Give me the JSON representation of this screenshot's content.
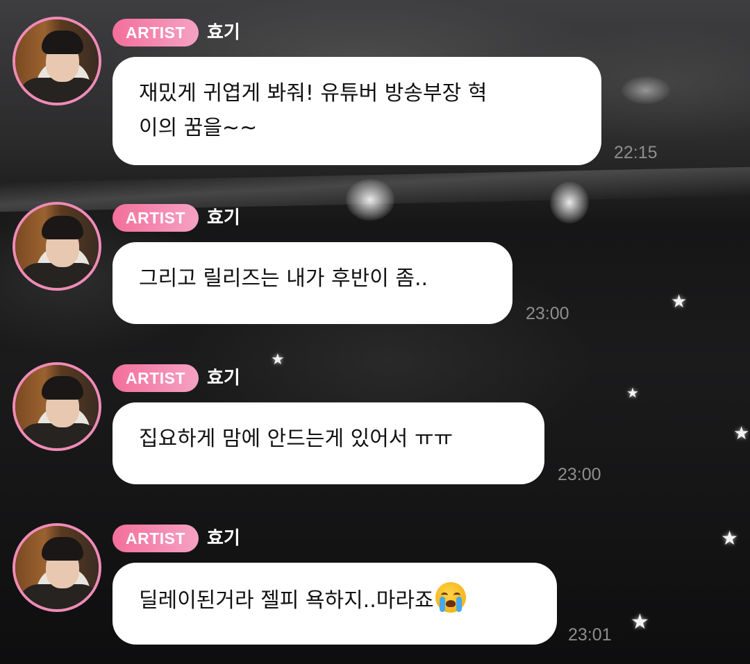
{
  "messages": [
    {
      "badge": "ARTIST",
      "sender": "효기",
      "text_lines": [
        "재밌게 귀엽게 봐줘! 유튜버 방송부장 혁",
        "이의 꿈을~~"
      ],
      "time": "22:15",
      "avatar": "artist-profile-photo"
    },
    {
      "badge": "ARTIST",
      "sender": "효기",
      "text_lines": [
        "그리고 릴리즈는 내가 후반이 좀.."
      ],
      "time": "23:00",
      "avatar": "artist-profile-photo"
    },
    {
      "badge": "ARTIST",
      "sender": "효기",
      "text_lines": [
        "집요하게 맘에 안드는게 있어서 ㅠㅠ"
      ],
      "time": "23:00",
      "avatar": "artist-profile-photo"
    },
    {
      "badge": "ARTIST",
      "sender": "효기",
      "text_lines": [
        "딜레이된거라 젤피 욕하지..마라죠"
      ],
      "emoji": "loudly-crying-face",
      "time": "23:01",
      "avatar": "artist-profile-photo"
    }
  ],
  "colors": {
    "badge_gradient_start": "#f36f9b",
    "badge_gradient_end": "#f5a2c3",
    "avatar_ring": "#f08bb6",
    "bubble": "#ffffff",
    "timestamp": "#8e8e8e"
  }
}
